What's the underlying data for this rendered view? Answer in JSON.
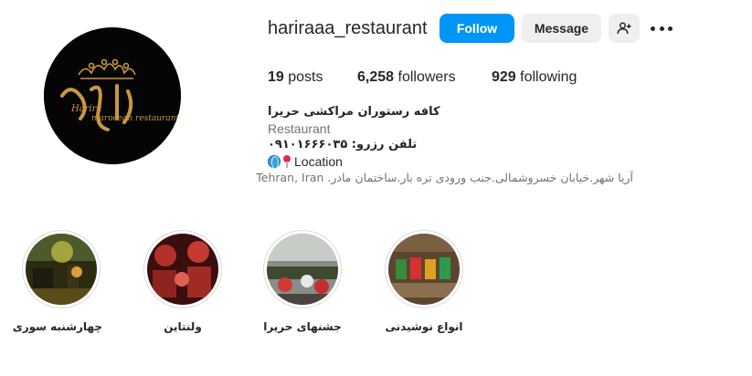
{
  "profile": {
    "username": "hariraaa_restaurant",
    "follow_label": "Follow",
    "message_label": "Message",
    "avatar_logo_script": "Harira",
    "avatar_logo_sub": "marocean restaurant"
  },
  "stats": {
    "posts_count": "19",
    "posts_label": "posts",
    "followers_count": "6,258",
    "followers_label": "followers",
    "following_count": "929",
    "following_label": "following"
  },
  "bio": {
    "name": "کافه رستوران مراکشی حریرا",
    "category": "Restaurant",
    "phone": "تلفن رزرو: ۰۹۱۰۱۶۶۶۰۳۵",
    "location_label": "Location",
    "address": "آریا شهر.خیابان خسروشمالی.جنب ورودی تره بار.ساختمان مادر. Tehran, Iran"
  },
  "highlights": [
    {
      "label": "چهارشنبه سوری"
    },
    {
      "label": "ولنتاین"
    },
    {
      "label": "جشنهای حریرا"
    },
    {
      "label": "انواع نوشیدنی"
    }
  ],
  "colors": {
    "follow_button": "#0095f6",
    "secondary_button": "#efefef",
    "muted_text": "#737373",
    "logo_gold": "#c9973f"
  },
  "icons": {
    "add_user": "person-add-icon",
    "more": "more-options-icon",
    "globe": "globe-icon",
    "pin": "location-pin-icon"
  }
}
